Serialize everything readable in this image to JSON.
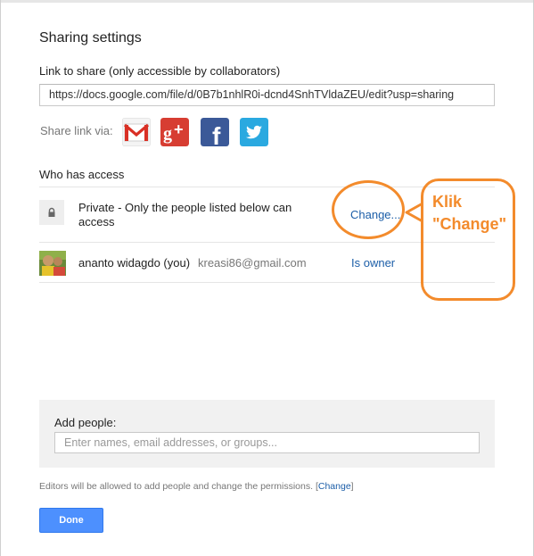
{
  "dialog": {
    "title": "Sharing settings",
    "link_label": "Link to share (only accessible by collaborators)",
    "link_value": "https://docs.google.com/file/d/0B7b1nhlR0i-dcnd4SnhTVldaZEU/edit?usp=sharing",
    "share_via_label": "Share link via:",
    "share_icons": [
      "gmail-icon",
      "google-plus-icon",
      "facebook-icon",
      "twitter-icon"
    ]
  },
  "access": {
    "label": "Who has access",
    "private_text": "Private - Only the people listed below can access",
    "change_label": "Change...",
    "user": {
      "name": "ananto widagdo (you)",
      "email": "kreasi86@gmail.com",
      "role": "Is owner"
    }
  },
  "add_people": {
    "label": "Add people:",
    "placeholder": "Enter names, email addresses, or groups..."
  },
  "footer": {
    "editors_note": "Editors will be allowed to add people and change the permissions.",
    "bracket_open": "[",
    "change_link": "Change",
    "bracket_close": "]",
    "done_label": "Done"
  },
  "annotation": {
    "text": "Klik\n\"Change\"",
    "color": "#f38b2c"
  },
  "colors": {
    "link": "#1c5ea8",
    "primary_button": "#4d90fe"
  }
}
